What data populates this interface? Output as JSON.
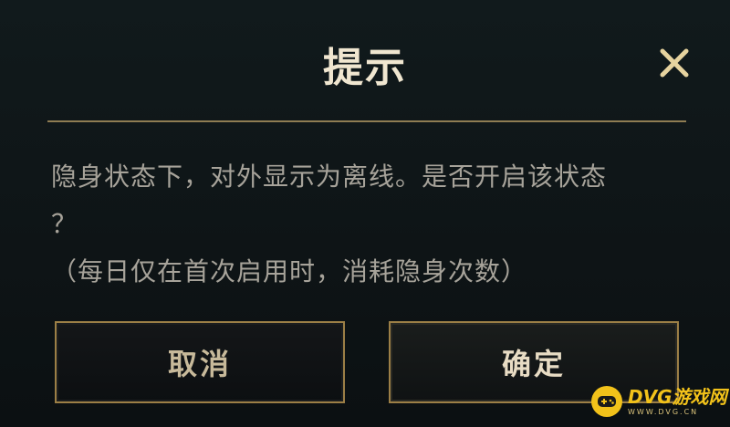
{
  "dialog": {
    "title": "提示",
    "close_icon": "close-icon",
    "message_lines": [
      "隐身状态下，对外显示为离线。是否开启该状态",
      "？",
      "（每日仅在首次启用时，消耗隐身次数）"
    ],
    "cancel_label": "取消",
    "confirm_label": "确定"
  },
  "watermark": {
    "brand": "DVG游戏网",
    "domain": "WWW.DVG.CN",
    "icon": "gamepad-icon"
  },
  "colors": {
    "background": "#0f1517",
    "title": "#f0e6d0",
    "gold_accent": "#9c7f46",
    "close": "#e6d39f",
    "body_text": "#a7a39a",
    "watermark": "#f2c21a"
  }
}
